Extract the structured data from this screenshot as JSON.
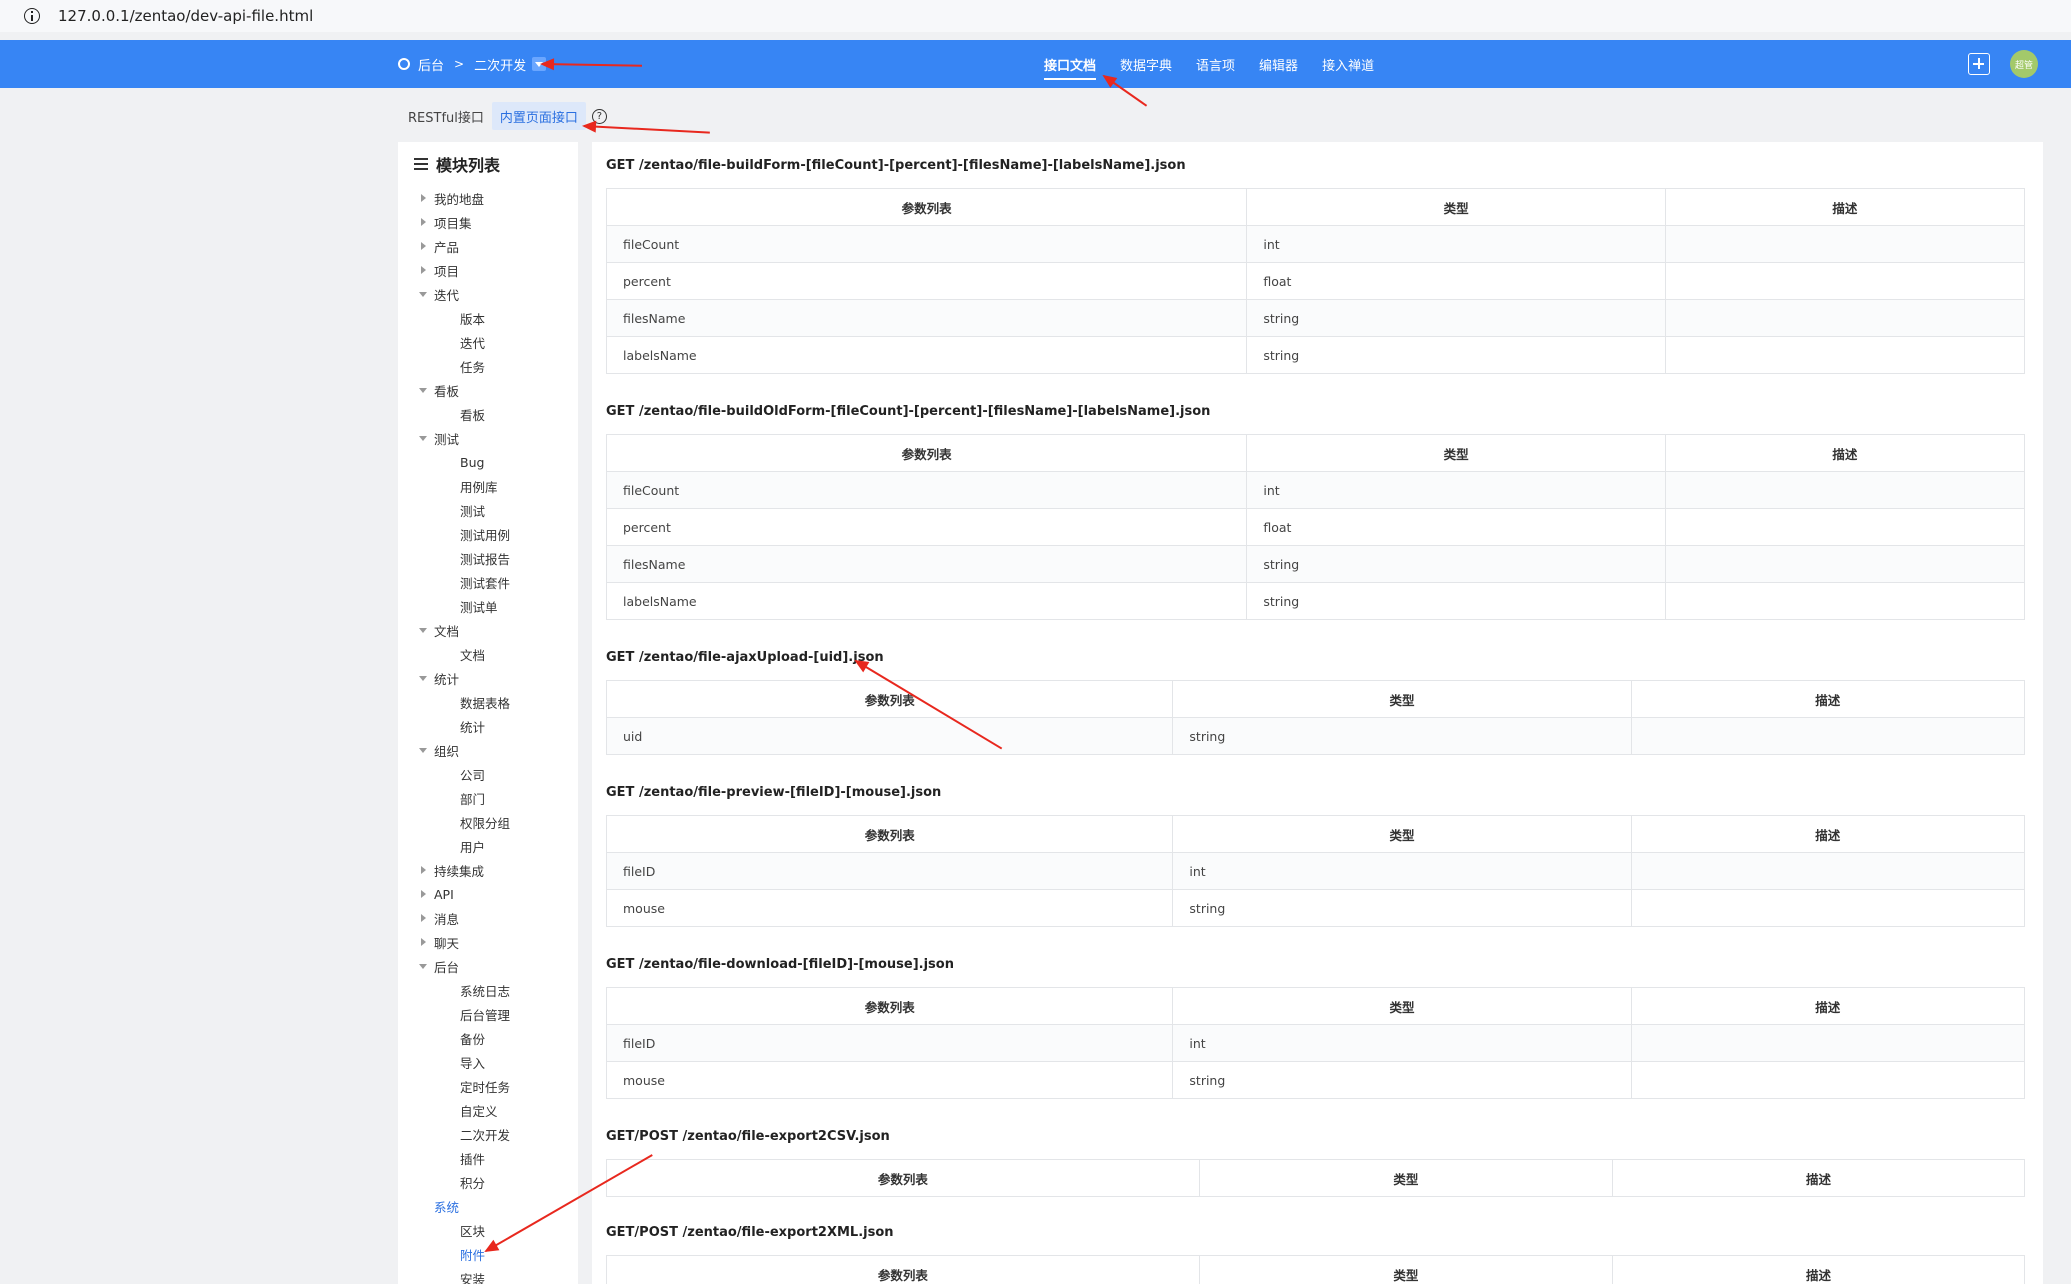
{
  "browser": {
    "url": "127.0.0.1/zentao/dev-api-file.html"
  },
  "nav": {
    "breadcrumb": [
      "后台",
      "二次开发"
    ],
    "menu": [
      "接口文档",
      "数据字典",
      "语言项",
      "编辑器",
      "接入禅道"
    ],
    "active_menu": "接口文档",
    "avatar_text": "超管"
  },
  "subtabs": [
    "RESTful接口",
    "内置页面接口"
  ],
  "sidebar": {
    "title": "模块列表",
    "items": [
      {
        "label": "我的地盘",
        "level": 1,
        "state": "collapsed"
      },
      {
        "label": "项目集",
        "level": 1,
        "state": "collapsed"
      },
      {
        "label": "产品",
        "level": 1,
        "state": "collapsed"
      },
      {
        "label": "项目",
        "level": 1,
        "state": "collapsed"
      },
      {
        "label": "迭代",
        "level": 1,
        "state": "expanded"
      },
      {
        "label": "版本",
        "level": 2
      },
      {
        "label": "迭代",
        "level": 2
      },
      {
        "label": "任务",
        "level": 2
      },
      {
        "label": "看板",
        "level": 1,
        "state": "expanded"
      },
      {
        "label": "看板",
        "level": 2
      },
      {
        "label": "测试",
        "level": 1,
        "state": "expanded"
      },
      {
        "label": "Bug",
        "level": 2
      },
      {
        "label": "用例库",
        "level": 2
      },
      {
        "label": "测试",
        "level": 2
      },
      {
        "label": "测试用例",
        "level": 2
      },
      {
        "label": "测试报告",
        "level": 2
      },
      {
        "label": "测试套件",
        "level": 2
      },
      {
        "label": "测试单",
        "level": 2
      },
      {
        "label": "文档",
        "level": 1,
        "state": "expanded"
      },
      {
        "label": "文档",
        "level": 2
      },
      {
        "label": "统计",
        "level": 1,
        "state": "expanded"
      },
      {
        "label": "数据表格",
        "level": 2
      },
      {
        "label": "统计",
        "level": 2
      },
      {
        "label": "组织",
        "level": 1,
        "state": "expanded"
      },
      {
        "label": "公司",
        "level": 2
      },
      {
        "label": "部门",
        "level": 2
      },
      {
        "label": "权限分组",
        "level": 2
      },
      {
        "label": "用户",
        "level": 2
      },
      {
        "label": "持续集成",
        "level": 1,
        "state": "collapsed"
      },
      {
        "label": "API",
        "level": 1,
        "state": "collapsed"
      },
      {
        "label": "消息",
        "level": 1,
        "state": "collapsed"
      },
      {
        "label": "聊天",
        "level": 1,
        "state": "collapsed"
      },
      {
        "label": "后台",
        "level": 1,
        "state": "expanded"
      },
      {
        "label": "系统日志",
        "level": 2
      },
      {
        "label": "后台管理",
        "level": 2
      },
      {
        "label": "备份",
        "level": 2
      },
      {
        "label": "导入",
        "level": 2
      },
      {
        "label": "定时任务",
        "level": 2
      },
      {
        "label": "自定义",
        "level": 2
      },
      {
        "label": "二次开发",
        "level": 2
      },
      {
        "label": "插件",
        "level": 2
      },
      {
        "label": "积分",
        "level": 2
      },
      {
        "label": "系统",
        "level": 1,
        "state": "leaf",
        "active": true
      },
      {
        "label": "区块",
        "level": 2
      },
      {
        "label": "附件",
        "level": 2,
        "active": true
      },
      {
        "label": "安装",
        "level": 2
      }
    ]
  },
  "table_headers": [
    "参数列表",
    "类型",
    "描述"
  ],
  "apis": [
    {
      "title": "GET /zentao/file-buildForm-[fileCount]-[percent]-[filesName]-[labelsName].json",
      "params": [
        [
          "fileCount",
          "int",
          ""
        ],
        [
          "percent",
          "float",
          ""
        ],
        [
          "filesName",
          "string",
          ""
        ],
        [
          "labelsName",
          "string",
          ""
        ]
      ]
    },
    {
      "title": "GET /zentao/file-buildOldForm-[fileCount]-[percent]-[filesName]-[labelsName].json",
      "params": [
        [
          "fileCount",
          "int",
          ""
        ],
        [
          "percent",
          "float",
          ""
        ],
        [
          "filesName",
          "string",
          ""
        ],
        [
          "labelsName",
          "string",
          ""
        ]
      ]
    },
    {
      "title": "GET /zentao/file-ajaxUpload-[uid].json",
      "params": [
        [
          "uid",
          "string",
          ""
        ]
      ]
    },
    {
      "title": "GET /zentao/file-preview-[fileID]-[mouse].json",
      "params": [
        [
          "fileID",
          "int",
          ""
        ],
        [
          "mouse",
          "string",
          ""
        ]
      ]
    },
    {
      "title": "GET /zentao/file-download-[fileID]-[mouse].json",
      "params": [
        [
          "fileID",
          "int",
          ""
        ],
        [
          "mouse",
          "string",
          ""
        ]
      ]
    },
    {
      "title": "GET/POST /zentao/file-export2CSV.json",
      "params": []
    },
    {
      "title": "GET/POST /zentao/file-export2XML.json",
      "params": []
    }
  ]
}
